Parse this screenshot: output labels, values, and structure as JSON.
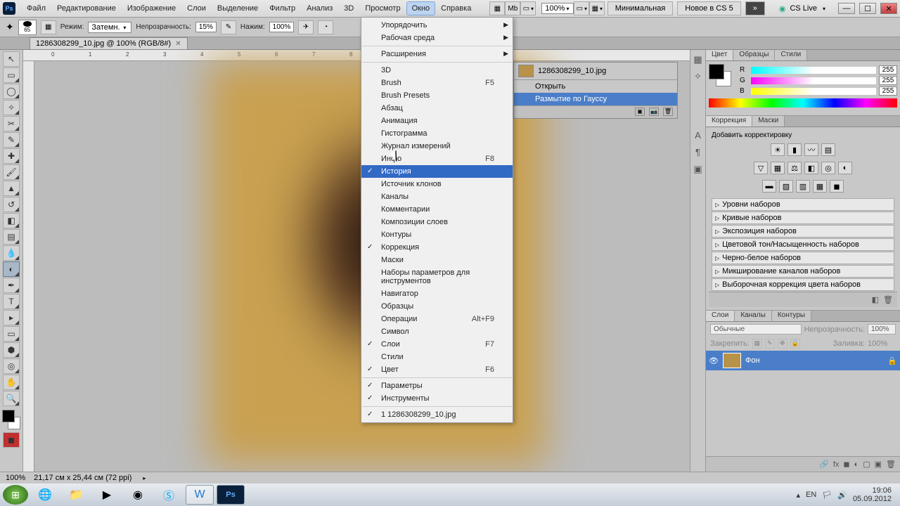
{
  "menubar": {
    "items": [
      "Файл",
      "Редактирование",
      "Изображение",
      "Слои",
      "Выделение",
      "Фильтр",
      "Анализ",
      "3D",
      "Просмотр",
      "Окно",
      "Справка"
    ],
    "active_index": 9,
    "zoom": "100%",
    "workspace_minimal": "Минимальная",
    "workspace_new": "Новое в CS 5",
    "cslive": "CS Live"
  },
  "optbar": {
    "mode_label": "Режим:",
    "mode_value": "Затемн.",
    "opacity_label": "Непрозрачность:",
    "opacity_value": "15%",
    "pressure_label": "Нажим:",
    "pressure_value": "100%",
    "brush_size": "65"
  },
  "doctab": {
    "title": "1286308299_10.jpg @ 100% (RGB/8#)"
  },
  "dropdown": {
    "groups": [
      [
        {
          "label": "Упорядочить",
          "sub": true
        },
        {
          "label": "Рабочая среда",
          "sub": true
        }
      ],
      [
        {
          "label": "Расширения",
          "sub": true
        }
      ],
      [
        {
          "label": "3D"
        },
        {
          "label": "Brush",
          "shortcut": "F5"
        },
        {
          "label": "Brush Presets"
        },
        {
          "label": "Абзац"
        },
        {
          "label": "Анимация"
        },
        {
          "label": "Гистограмма"
        },
        {
          "label": "Журнал измерений"
        },
        {
          "label": "Инфо",
          "shortcut": "F8"
        },
        {
          "label": "История",
          "highlighted": true,
          "checked": true
        },
        {
          "label": "Источник клонов"
        },
        {
          "label": "Каналы"
        },
        {
          "label": "Комментарии"
        },
        {
          "label": "Композиции слоев"
        },
        {
          "label": "Контуры"
        },
        {
          "label": "Коррекция",
          "checked": true
        },
        {
          "label": "Маски"
        },
        {
          "label": "Наборы параметров для инструментов"
        },
        {
          "label": "Навигатор"
        },
        {
          "label": "Образцы"
        },
        {
          "label": "Операции",
          "shortcut": "Alt+F9"
        },
        {
          "label": "Символ"
        },
        {
          "label": "Слои",
          "shortcut": "F7",
          "checked": true
        },
        {
          "label": "Стили"
        },
        {
          "label": "Цвет",
          "shortcut": "F6",
          "checked": true
        }
      ],
      [
        {
          "label": "Параметры",
          "checked": true
        },
        {
          "label": "Инструменты",
          "checked": true
        }
      ],
      [
        {
          "label": "1 1286308299_10.jpg",
          "checked": true
        }
      ]
    ]
  },
  "history": {
    "doc_name": "1286308299_10.jpg",
    "items": [
      "Открыть",
      "Размытие по Гауссу"
    ],
    "selected_index": 1
  },
  "color_panel": {
    "tabs": [
      "Цвет",
      "Образцы",
      "Стили"
    ],
    "r": "255",
    "g": "255",
    "b": "255"
  },
  "adjustments": {
    "tabs": [
      "Коррекция",
      "Маски"
    ],
    "add_label": "Добавить корректировку",
    "presets": [
      "Уровни наборов",
      "Кривые наборов",
      "Экспозиция наборов",
      "Цветовой тон/Насыщенность наборов",
      "Черно-белое наборов",
      "Микширование каналов наборов",
      "Выборочная коррекция цвета наборов"
    ]
  },
  "layers": {
    "tabs": [
      "Слои",
      "Каналы",
      "Контуры"
    ],
    "blend_mode": "Обычные",
    "opacity_label": "Непрозрачность:",
    "opacity_val": "100%",
    "lock_label": "Закрепить:",
    "fill_label": "Заливка:",
    "fill_val": "100%",
    "layer_name": "Фон"
  },
  "status": {
    "zoom": "100%",
    "doc_size": "21,17 см x 25,44 см (72 ppi)"
  },
  "taskbar": {
    "lang": "EN",
    "time": "19:06",
    "date": "05.09.2012"
  }
}
